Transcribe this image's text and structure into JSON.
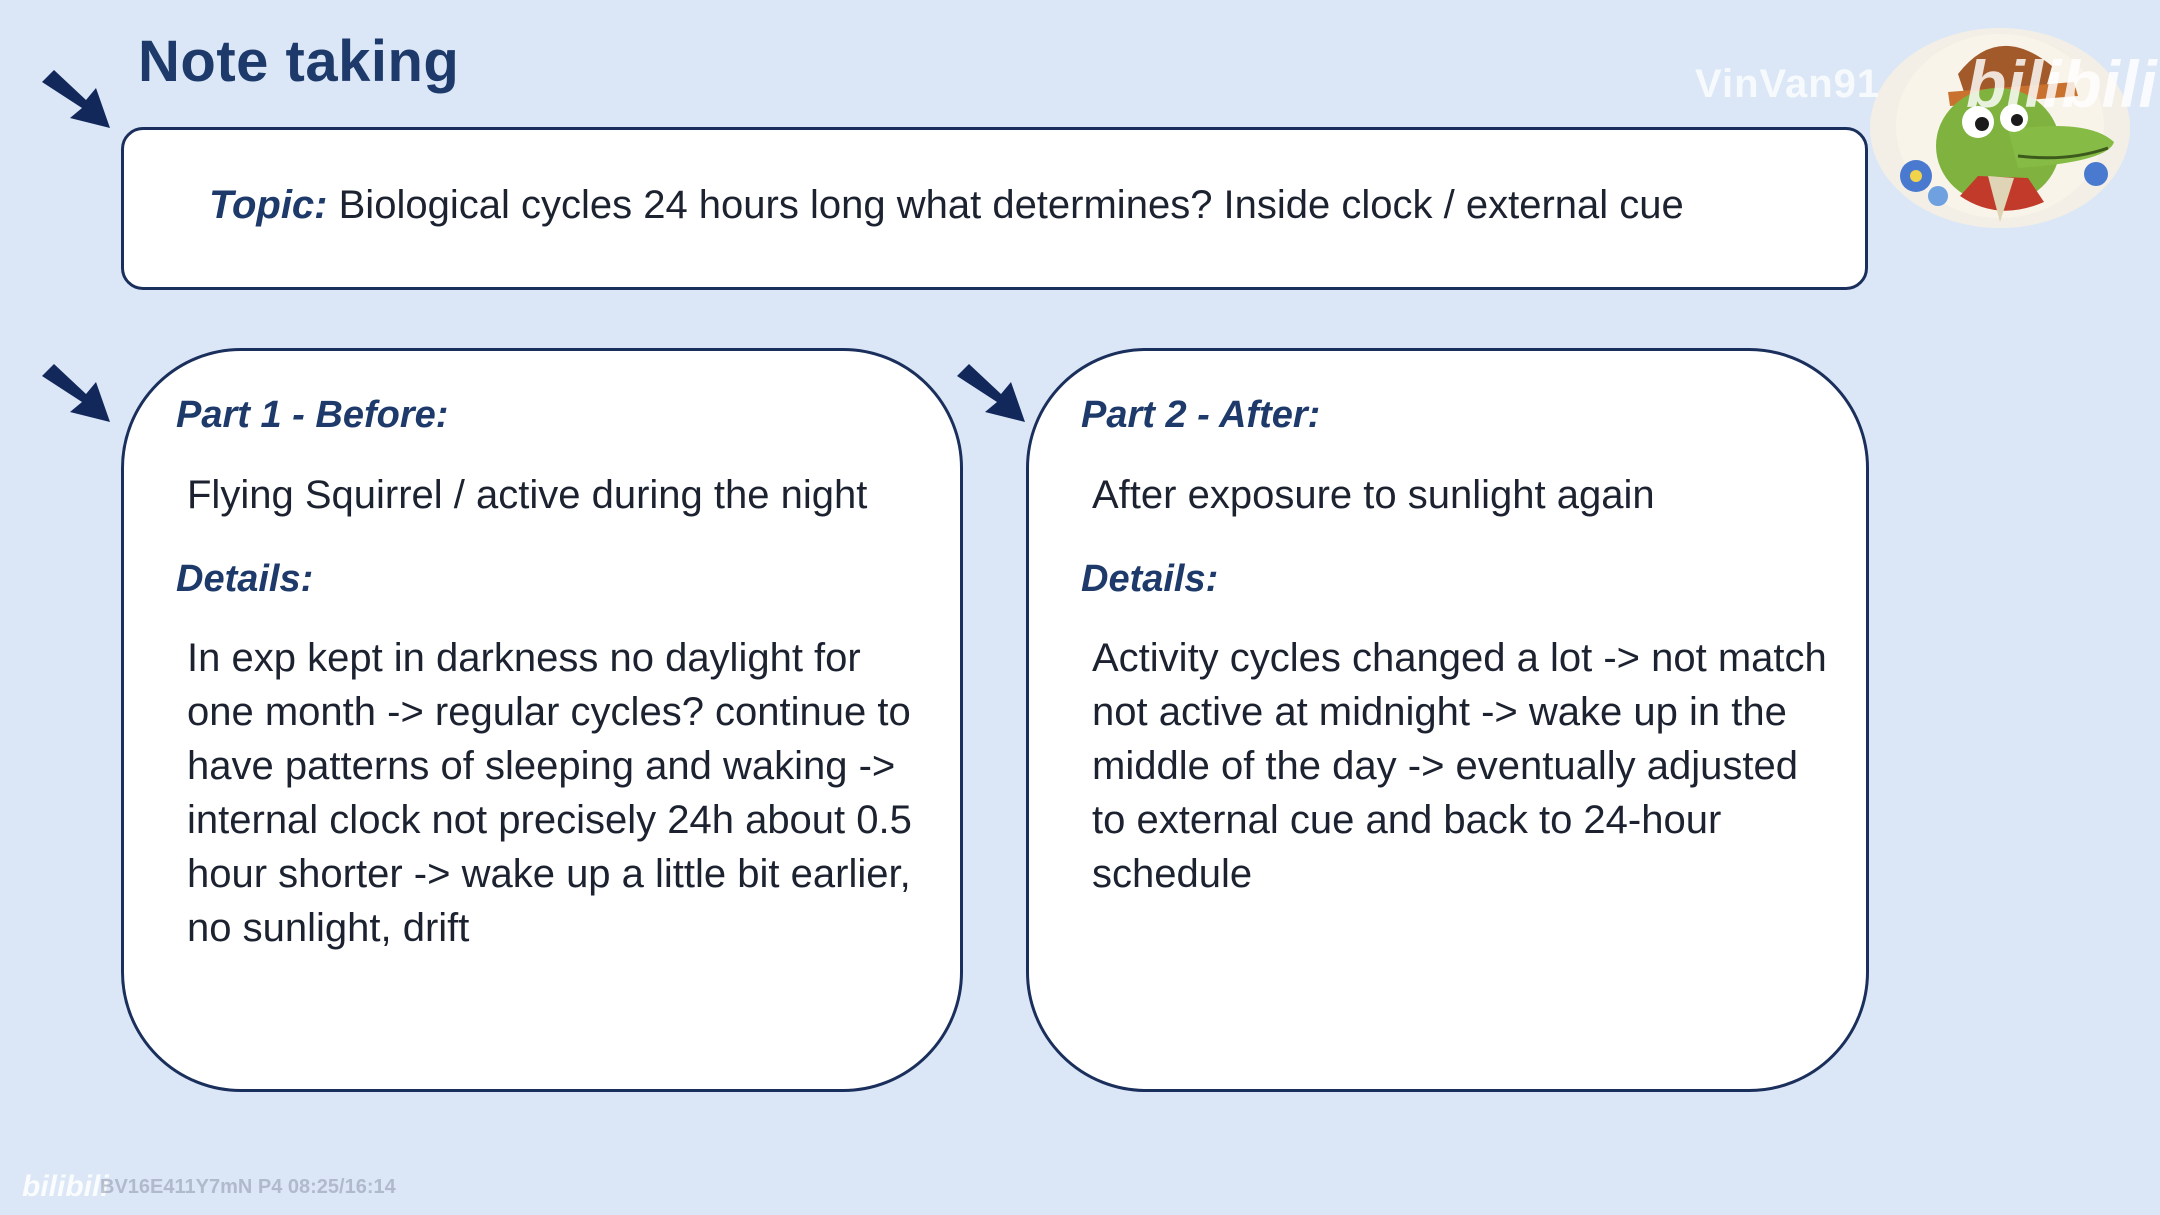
{
  "slide": {
    "title": "Note taking",
    "topic": {
      "label": "Topic:",
      "text": "Biological cycles 24 hours long what determines? Inside clock / external cue"
    },
    "part1": {
      "heading": "Part 1 - Before:",
      "line": "Flying Squirrel / active during the night",
      "details_heading": "Details:",
      "details": "In exp kept in darkness no daylight for one month -> regular cycles? continue to have patterns of sleeping and waking -> internal clock not precisely 24h about 0.5 hour shorter -> wake up a little bit earlier, no sunlight, drift"
    },
    "part2": {
      "heading": "Part 2 - After:",
      "line": "After exposure to sunlight again",
      "details_heading": "Details:",
      "details": "Activity cycles changed a lot -> not match not active at midnight -> wake up in the middle of the day -> eventually adjusted to external cue and back to 24-hour schedule"
    }
  },
  "watermark": {
    "uploader": "VinVan91",
    "logo": "bilibili",
    "footer_logo": "bilibili",
    "footer_text": "BV16E411Y7mN P4 08:25/16:14"
  },
  "colors": {
    "background": "#dbe7f6",
    "heading": "#1d3a6a",
    "border": "#1a2f5c",
    "arrow": "#12285a"
  },
  "icons": {
    "arrows": "arrow-down-right-icon",
    "avatar": "crocodile-avatar"
  }
}
